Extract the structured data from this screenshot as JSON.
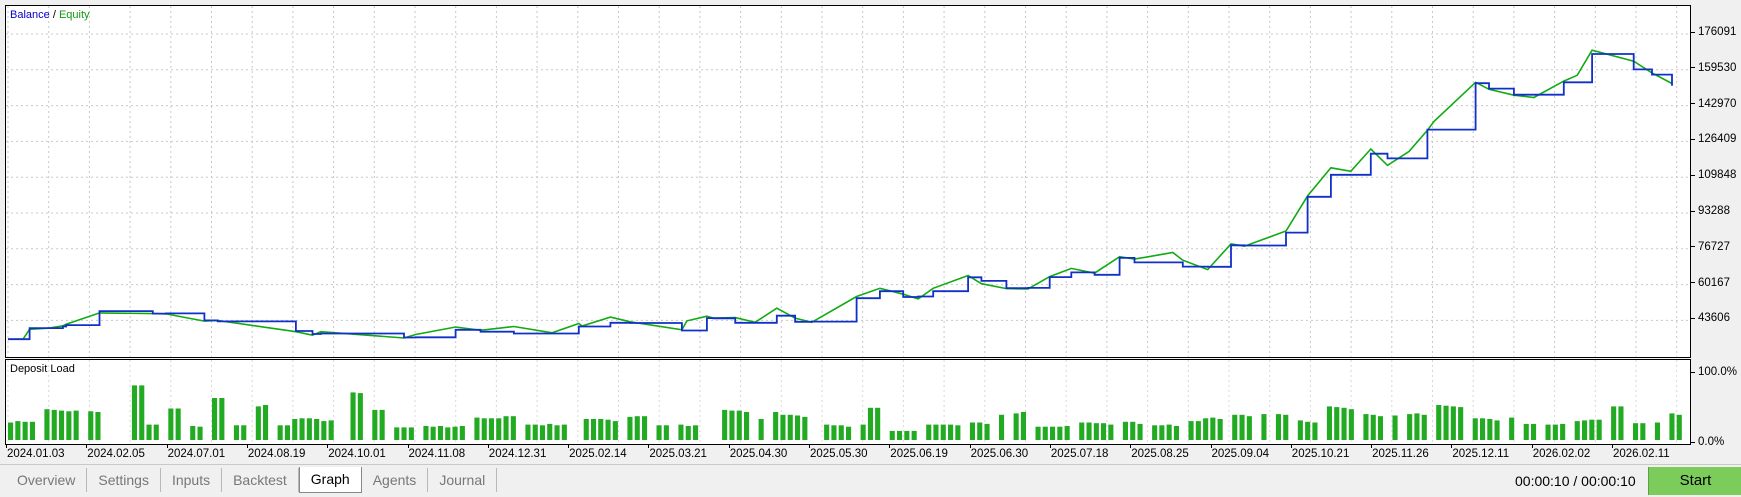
{
  "main_chart": {
    "legend": {
      "balance_label": "Balance",
      "separator": "/",
      "equity_label": "Equity"
    },
    "colors": {
      "balance": "#1030c8",
      "equity": "#11aa11",
      "grid": "#c8c8c8"
    }
  },
  "load_panel": {
    "title": "Deposit Load",
    "bar_color": "#22aa22"
  },
  "y_axis_main": {
    "ticks": [
      "176091",
      "159530",
      "142970",
      "126409",
      "109848",
      "93288",
      "76727",
      "60167",
      "43606"
    ]
  },
  "y_axis_load": {
    "ticks": [
      "100.0%",
      "0.0%"
    ]
  },
  "x_axis": {
    "ticks": [
      "2024.01.03",
      "2024.02.05",
      "2024.07.01",
      "2024.08.19",
      "2024.10.01",
      "2024.11.08",
      "2024.12.31",
      "2025.02.14",
      "2025.03.21",
      "2025.04.30",
      "2025.05.30",
      "2025.06.19",
      "2025.06.30",
      "2025.07.18",
      "2025.08.25",
      "2025.09.04",
      "2025.10.21",
      "2025.11.26",
      "2025.12.11",
      "2026.02.02",
      "2026.02.11"
    ]
  },
  "chart_data": [
    {
      "type": "line",
      "title": "",
      "ylim": [
        43606,
        192652
      ],
      "x": [
        0,
        0.009,
        0.013,
        0.025,
        0.033,
        0.035,
        0.055,
        0.087,
        0.095,
        0.118,
        0.126,
        0.173,
        0.183,
        0.188,
        0.238,
        0.245,
        0.269,
        0.284,
        0.304,
        0.327,
        0.343,
        0.345,
        0.362,
        0.374,
        0.405,
        0.408,
        0.42,
        0.424,
        0.437,
        0.449,
        0.462,
        0.473,
        0.483,
        0.51,
        0.524,
        0.538,
        0.547,
        0.556,
        0.577,
        0.585,
        0.6,
        0.613,
        0.626,
        0.639,
        0.653,
        0.668,
        0.677,
        0.7,
        0.706,
        0.721,
        0.735,
        0.743,
        0.768,
        0.781,
        0.795,
        0.807,
        0.819,
        0.829,
        0.842,
        0.853,
        0.857,
        0.882,
        0.89,
        0.905,
        0.917,
        0.935,
        0.943,
        0.952,
        0.977,
        0.988,
        1.0
      ],
      "series": [
        {
          "name": "Balance",
          "values": [
            50800,
            50800,
            55500,
            55500,
            56200,
            56800,
            62800,
            61700,
            61800,
            58800,
            58400,
            54300,
            53000,
            53200,
            51500,
            51600,
            54800,
            54000,
            53200,
            53200,
            56200,
            56200,
            57800,
            57700,
            54500,
            54500,
            59800,
            59700,
            57800,
            57800,
            60800,
            58200,
            58300,
            68300,
            71300,
            68800,
            69000,
            71300,
            77200,
            75700,
            72600,
            72700,
            77300,
            79300,
            78300,
            85500,
            83600,
            83600,
            81800,
            81700,
            90900,
            90800,
            96300,
            111600,
            121000,
            121000,
            130000,
            128000,
            128000,
            140300,
            140300,
            160100,
            157800,
            155200,
            155200,
            160500,
            160500,
            172600,
            166000,
            163800,
            159000
          ]
        },
        {
          "name": "Equity",
          "values": [
            50800,
            50800,
            55000,
            55500,
            56500,
            57200,
            62000,
            61700,
            61600,
            58500,
            58800,
            54000,
            52500,
            54000,
            51300,
            52800,
            56000,
            54600,
            56200,
            53500,
            57500,
            56400,
            60200,
            58200,
            54800,
            58600,
            60600,
            59800,
            60000,
            58000,
            64000,
            59800,
            58000,
            69000,
            72500,
            70000,
            68000,
            72500,
            78000,
            74500,
            72400,
            72200,
            77500,
            81000,
            79000,
            86000,
            85000,
            87800,
            84500,
            80500,
            91500,
            90500,
            97000,
            112000,
            124000,
            122500,
            132000,
            125000,
            131000,
            140000,
            143800,
            160500,
            157500,
            155000,
            154000,
            161000,
            163500,
            174200,
            169500,
            164500,
            160000
          ]
        }
      ]
    },
    {
      "type": "bar",
      "title": "Deposit Load",
      "ylim": [
        0,
        100
      ],
      "values": [
        25,
        27,
        26,
        26,
        0,
        44,
        43,
        42,
        41,
        42,
        0,
        41,
        40,
        0,
        0,
        0,
        0,
        78,
        78,
        22,
        22,
        0,
        45,
        45,
        0,
        20,
        19,
        0,
        60,
        60,
        0,
        21,
        21,
        0,
        48,
        50,
        0,
        21,
        21,
        30,
        31,
        31,
        30,
        27,
        28,
        0,
        0,
        68,
        67,
        0,
        43,
        43,
        0,
        18,
        18,
        18,
        0,
        20,
        19,
        20,
        18,
        19,
        20,
        0,
        32,
        31,
        31,
        31,
        34,
        34,
        0,
        22,
        22,
        21,
        23,
        21,
        22,
        0,
        0,
        30,
        30,
        30,
        29,
        27,
        0,
        33,
        34,
        34,
        0,
        21,
        21,
        0,
        22,
        20,
        21,
        0,
        0,
        0,
        43,
        42,
        42,
        40,
        0,
        30,
        0,
        40,
        36,
        36,
        35,
        33,
        0,
        0,
        22,
        21,
        21,
        19,
        0,
        22,
        46,
        46,
        0,
        13,
        13,
        13,
        13,
        0,
        22,
        22,
        22,
        22,
        21,
        0,
        25,
        25,
        23,
        0,
        36,
        0,
        38,
        40,
        0,
        19,
        19,
        19,
        19,
        20,
        0,
        25,
        25,
        24,
        24,
        22,
        0,
        26,
        26,
        23,
        0,
        21,
        21,
        22,
        20,
        0,
        27,
        27,
        31,
        32,
        30,
        0,
        36,
        36,
        34,
        0,
        37,
        0,
        37,
        36,
        0,
        28,
        26,
        25,
        0,
        48,
        47,
        46,
        44,
        0,
        37,
        36,
        34,
        0,
        35,
        0,
        37,
        38,
        36,
        0,
        50,
        49,
        48,
        47,
        0,
        31,
        31,
        30,
        28,
        0,
        32,
        0,
        23,
        23,
        0,
        22,
        22,
        23,
        0,
        27,
        28,
        29,
        29,
        0,
        48,
        48,
        0,
        24,
        24,
        0,
        25,
        0,
        38,
        36
      ]
    }
  ],
  "bottom_bar": {
    "tabs": [
      {
        "label": "Overview",
        "active": false
      },
      {
        "label": "Settings",
        "active": false
      },
      {
        "label": "Inputs",
        "active": false
      },
      {
        "label": "Backtest",
        "active": false
      },
      {
        "label": "Graph",
        "active": true
      },
      {
        "label": "Agents",
        "active": false
      },
      {
        "label": "Journal",
        "active": false
      }
    ],
    "timer": "00:00:10 / 00:00:10",
    "start_label": "Start"
  }
}
